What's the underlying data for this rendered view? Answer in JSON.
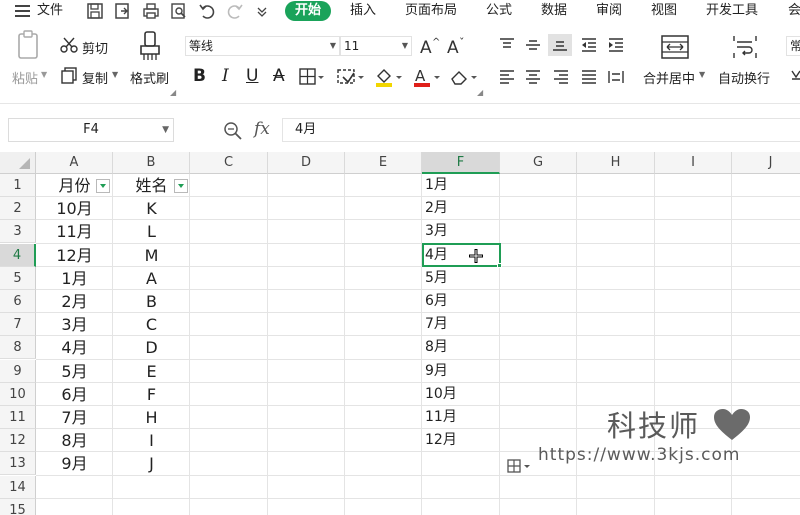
{
  "menu": {
    "hamburger_icon": "menu-icon",
    "file_label": "文件",
    "tabs": [
      "开始",
      "插入",
      "页面布局",
      "公式",
      "数据",
      "审阅",
      "视图",
      "开发工具",
      "会"
    ],
    "active_tab": "开始"
  },
  "ribbon": {
    "paste_label": "粘贴",
    "cut_label": "剪切",
    "copy_label": "复制",
    "format_painter_label": "格式刷",
    "font_name": "等线",
    "font_size": "11",
    "bold": "B",
    "italic": "I",
    "underline": "U",
    "strike": "A",
    "font_color_letter": "A",
    "merge_label": "合并居中",
    "wrap_label": "自动换行",
    "number_format_partial": "常",
    "accent_color": "#1aa35a",
    "fill_color": "#f2d600",
    "font_color": "#e0201a"
  },
  "formula_bar": {
    "cell_ref": "F4",
    "fx_label": "fx",
    "value": "4月"
  },
  "sheet": {
    "columns": [
      "A",
      "B",
      "C",
      "D",
      "E",
      "F",
      "G",
      "H",
      "I",
      "J"
    ],
    "selected_column": "F",
    "rows": [
      "1",
      "2",
      "3",
      "4",
      "5",
      "6",
      "7",
      "8",
      "9",
      "10",
      "11",
      "12",
      "13",
      "14",
      "15"
    ],
    "selected_row": "4",
    "col_a": [
      "月份",
      "10月",
      "11月",
      "12月",
      "1月",
      "2月",
      "3月",
      "4月",
      "5月",
      "6月",
      "7月",
      "8月",
      "9月"
    ],
    "col_b": [
      "姓名",
      "K",
      "L",
      "M",
      "A",
      "B",
      "C",
      "D",
      "E",
      "F",
      "H",
      "I",
      "J"
    ],
    "col_f": [
      "1月",
      "2月",
      "3月",
      "4月",
      "5月",
      "6月",
      "7月",
      "8月",
      "9月",
      "10月",
      "11月",
      "12月"
    ]
  },
  "watermark": {
    "title": "科技师",
    "url": "https://www.3kjs.com"
  }
}
